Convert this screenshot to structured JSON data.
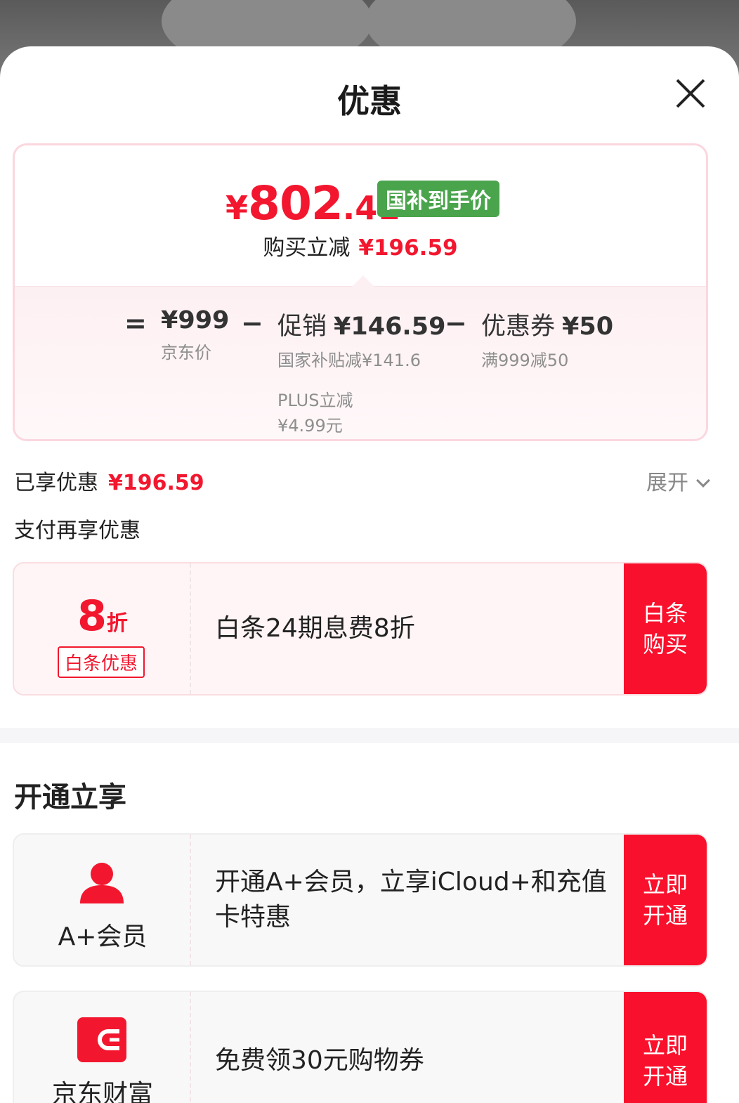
{
  "sheet": {
    "title": "优惠"
  },
  "price_summary": {
    "currency": "¥",
    "final_integer": "802",
    "final_decimal": ".41",
    "badge": "国补到手价",
    "reduce_label": "购买立减",
    "reduce_amount": "¥196.59"
  },
  "breakdown": {
    "equals": "=",
    "minus": "−",
    "jd_price_value": "¥999",
    "jd_price_label": "京东价",
    "promo_label": "促销",
    "promo_value": "¥146.59",
    "promo_sub1": "国家补贴减¥141.6",
    "promo_sub2": "PLUS立减",
    "promo_sub3": "¥4.99元",
    "coupon_label": "优惠券",
    "coupon_value": "¥50",
    "coupon_sub": "满999减50"
  },
  "enjoyed": {
    "label": "已享优惠",
    "amount": "¥196.59",
    "expand_label": "展开"
  },
  "pay_more": {
    "label": "支付再享优惠"
  },
  "baitiao_offer": {
    "discount_number": "8",
    "discount_unit": "折",
    "tag": "白条优惠",
    "description": "白条24期息费8折",
    "button_line1": "白条",
    "button_line2": "购买"
  },
  "open_section": {
    "title": "开通立享"
  },
  "aplus_offer": {
    "label": "A+会员",
    "description": "开通A+会员，立享iCloud+和充值卡特惠",
    "button_line1": "立即",
    "button_line2": "开通",
    "icon": "user-icon"
  },
  "jdwealth_offer": {
    "label": "京东财富",
    "description": "免费领30元购物券",
    "button_line1": "立即",
    "button_line2": "开通",
    "icon": "wallet-icon"
  },
  "colors": {
    "accent_red": "#f2172f",
    "button_red": "#f9102c",
    "badge_green": "#4aa44c"
  }
}
